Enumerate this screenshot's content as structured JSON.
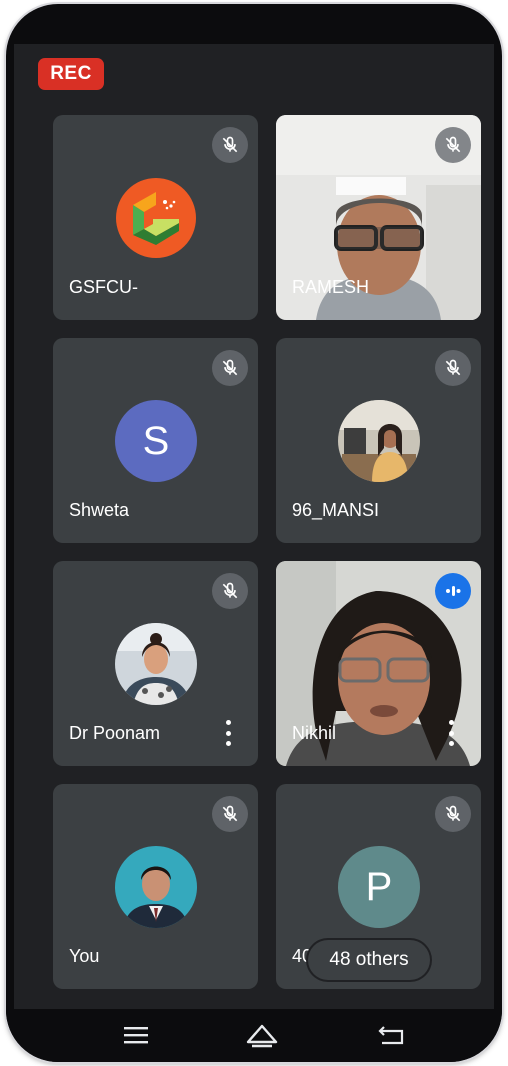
{
  "recording": {
    "label": "REC"
  },
  "tiles": [
    {
      "name": "GSFCU-",
      "avatar": "gsfcu-logo",
      "mic": "muted"
    },
    {
      "name": "RAMESH",
      "avatar": "camera-video",
      "mic": "muted"
    },
    {
      "name": "Shweta",
      "avatar": "letter",
      "letter": "S",
      "avatar_color": "#5c6bc0",
      "mic": "muted"
    },
    {
      "name": "96_MANSI",
      "avatar": "photo",
      "mic": "muted"
    },
    {
      "name": "Dr Poonam",
      "avatar": "photo",
      "mic": "muted",
      "menu": "more-vert-icon"
    },
    {
      "name": "Nikhil",
      "avatar": "camera-video",
      "mic": "speaking",
      "menu": "more-vert-icon"
    },
    {
      "name": "You",
      "avatar": "photo",
      "mic": "muted"
    },
    {
      "name": "4019_C",
      "avatar": "letter",
      "letter": "P",
      "avatar_color": "#5f8a8b",
      "mic": "muted"
    }
  ],
  "overflow": {
    "label": "48 others"
  },
  "navigation": {
    "buttons": [
      "menu-lines-icon",
      "home-icon",
      "back-icon"
    ]
  },
  "colors": {
    "rec": "#d93025",
    "tile": "#3c4043",
    "background": "#202124",
    "speaking": "#1a73e8"
  }
}
